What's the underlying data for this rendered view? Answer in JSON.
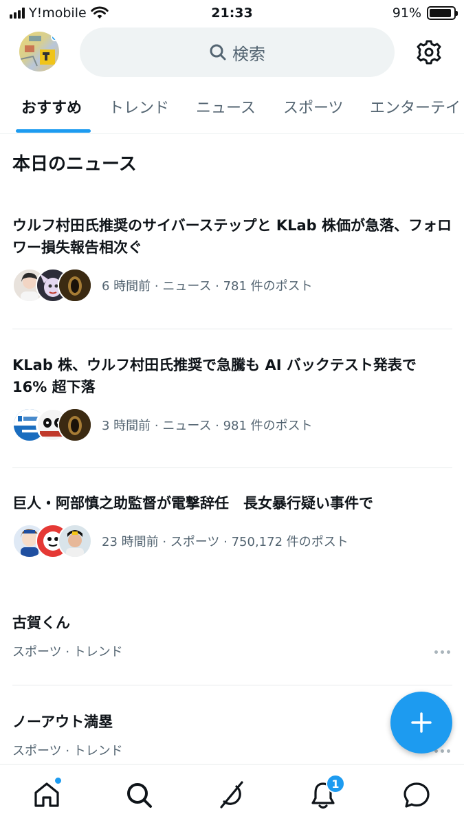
{
  "status_bar": {
    "carrier": "Y!mobile",
    "time": "21:33",
    "battery": "91%",
    "battery_level": 0.91
  },
  "header": {
    "search_placeholder": "検索",
    "avatar_has_notification": true
  },
  "tabs": [
    {
      "label": "おすすめ",
      "active": true
    },
    {
      "label": "トレンド",
      "active": false
    },
    {
      "label": "ニュース",
      "active": false
    },
    {
      "label": "スポーツ",
      "active": false
    },
    {
      "label": "エンターテイ",
      "active": false
    }
  ],
  "section_title": "本日のニュース",
  "news": [
    {
      "headline": "ウルフ村田氏推奨のサイバーステップと KLab 株価が急落、フォロワー損失報告相次ぐ",
      "meta": "6 時間前 · ニュース · 781 件のポスト"
    },
    {
      "headline": "KLab 株、ウルフ村田氏推奨で急騰も AI バックテスト発表で 16% 超下落",
      "meta": "3 時間前 · ニュース · 981 件のポスト"
    },
    {
      "headline": "巨人・阿部慎之助監督が電撃辞任　長女暴行疑い事件で",
      "meta": "23 時間前 · スポーツ · 750,172 件のポスト"
    }
  ],
  "trends": [
    {
      "name": "古賀くん",
      "category": "スポーツ · トレンド"
    },
    {
      "name": "ノーアウト満塁",
      "category": "スポーツ · トレンド"
    }
  ],
  "nav": {
    "home_dot": true,
    "notifications_badge": "1"
  },
  "colors": {
    "accent": "#1d9bf0",
    "text_primary": "#0f1419",
    "text_secondary": "#536471",
    "search_bg": "#eff3f4"
  },
  "icons": [
    "search-icon",
    "gear-icon",
    "more-icon",
    "plus-icon",
    "home-icon",
    "explore-icon",
    "grok-icon",
    "bell-icon",
    "messages-icon"
  ]
}
